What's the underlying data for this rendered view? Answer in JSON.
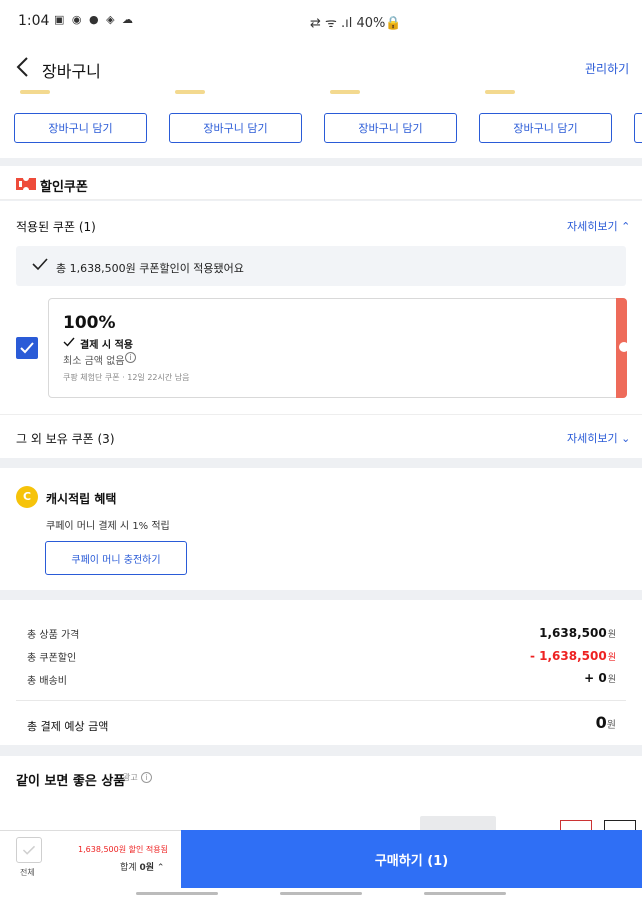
{
  "status_bar": {
    "time": "1:04",
    "left_icons": "▣ ◉ ● ◈ ☁",
    "right_text": "⇄ ᯤ .ıl 40%🔒"
  },
  "header": {
    "title": "장바구니",
    "manage": "관리하기"
  },
  "product_strip": {
    "buttons": [
      "장바구니 담기",
      "장바구니 담기",
      "장바구니 담기",
      "장바구니 담기"
    ]
  },
  "coupons": {
    "section_title": "할인쿠폰",
    "applied_title": "적용된 쿠폰 (1)",
    "applied_detail": "자세히보기",
    "notice": "총 1,638,500원 쿠폰할인이 적용됐어요",
    "card": {
      "percent": "100%",
      "pay_apply": "결제 시 적용",
      "min_amount": "최소 금액 없음",
      "description": "쿠팡 체험단 쿠폰 · 12일 22시간 남음"
    },
    "other_title": "그 외 보유 쿠폰 (3)",
    "other_detail": "자세히보기"
  },
  "cash": {
    "coin": "C",
    "title": "캐시적립 혜택",
    "desc": "쿠페이 머니 결제 시 1% 적립",
    "button": "쿠페이 머니 충전하기"
  },
  "totals": {
    "product_label": "총 상품 가격",
    "product_value": "1,638,500",
    "coupon_label": "총 쿠폰할인",
    "coupon_value": "- 1,638,500",
    "shipping_label": "총 배송비",
    "shipping_value": "+ 0",
    "won": "원",
    "grand_label": "총 결제 예상 금액",
    "grand_value": "0"
  },
  "recommended": {
    "title": "같이 보면 좋은 상품",
    "ad": "광고",
    "info": "i"
  },
  "bottom_bar": {
    "all_label": "전체",
    "discount_text": "1,638,500원 할인 적용됨",
    "sum_label": "합계",
    "sum_value": "0원",
    "buy_button": "구매하기 (1)"
  },
  "colors": {
    "accent": "#2a5bd7",
    "buy": "#2f6ff5",
    "coupon_stripe": "#ee6b5a",
    "discount_red": "#e22222",
    "coin": "#f6c30a"
  }
}
